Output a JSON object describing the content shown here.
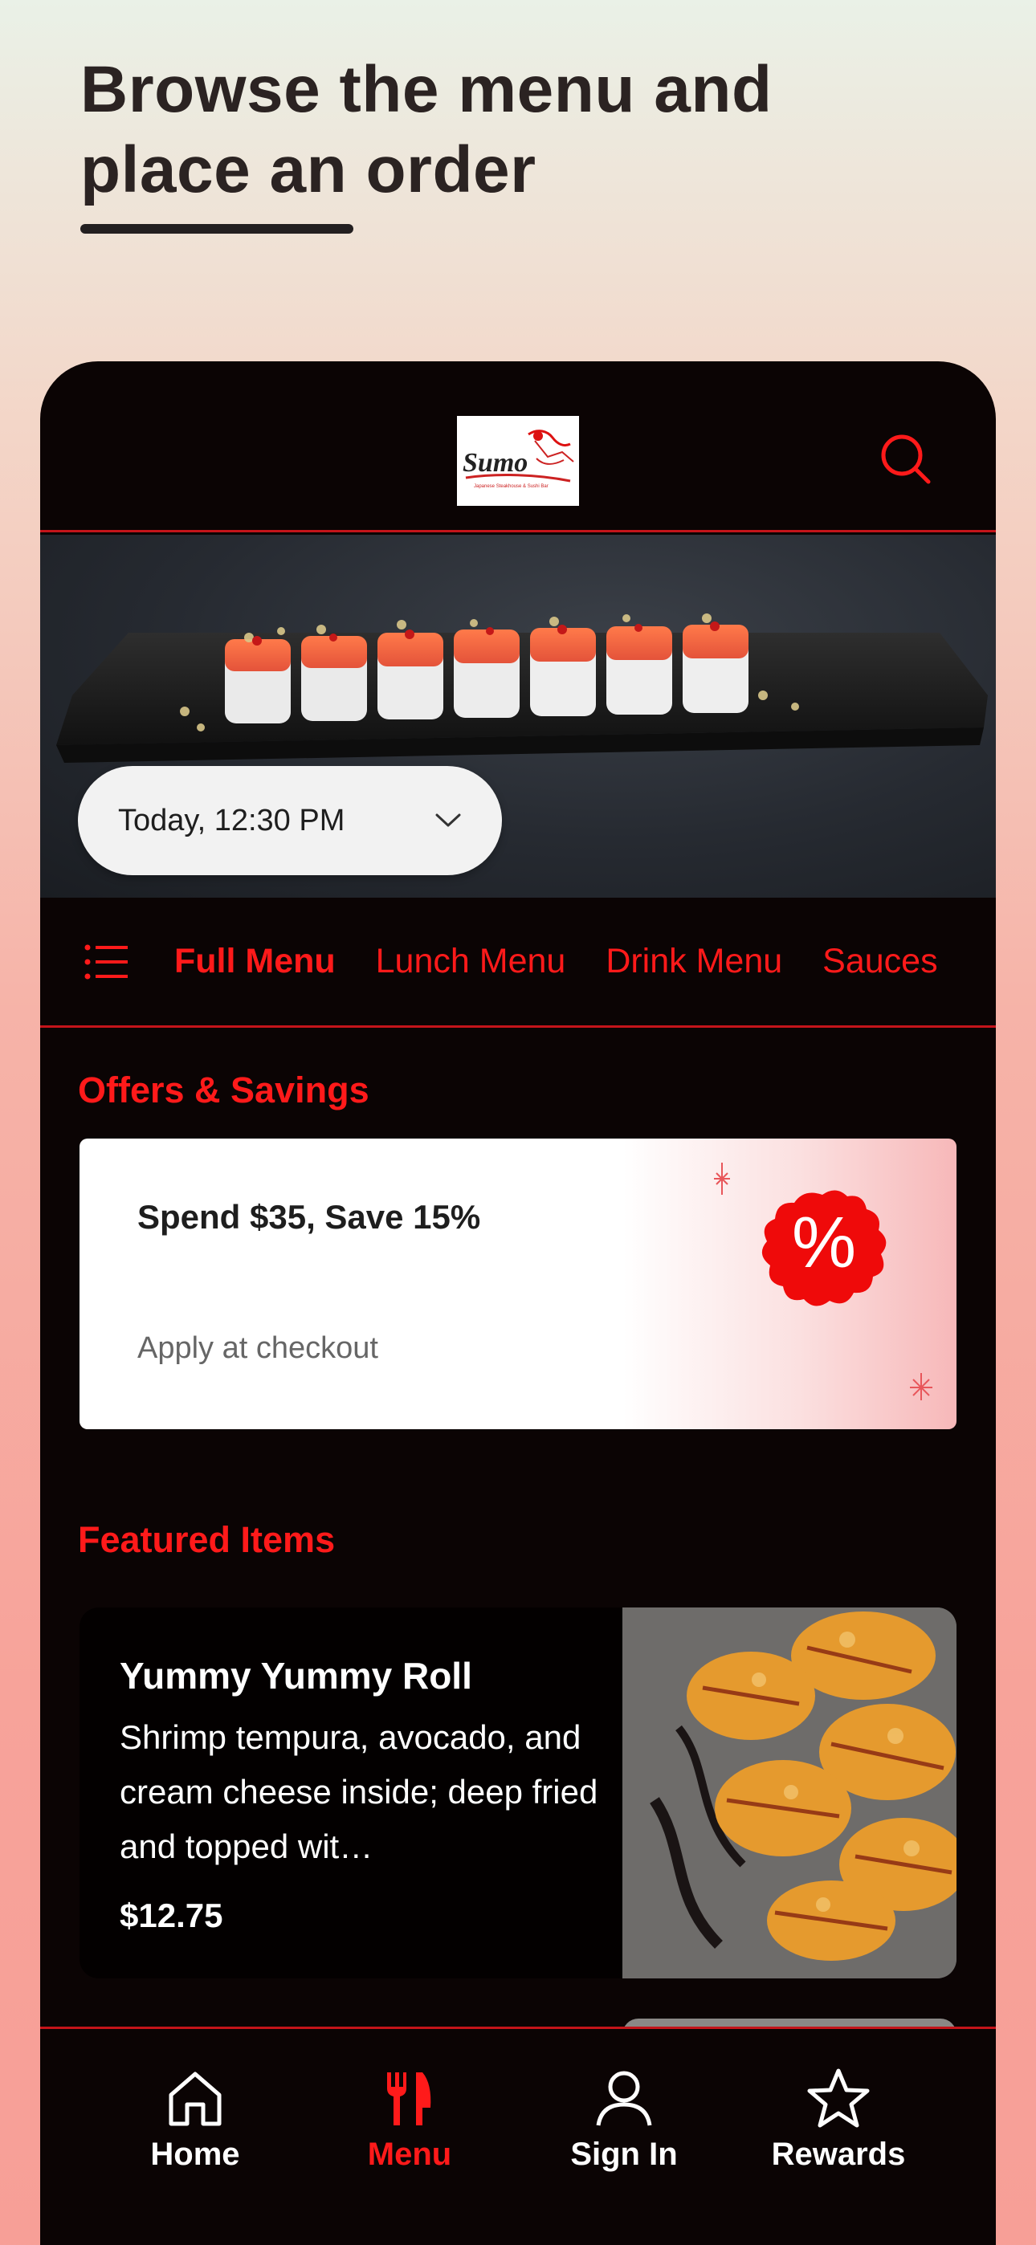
{
  "headline": {
    "line1": "Browse the menu and",
    "line2": "place an order"
  },
  "header": {
    "logo_text": "Sumo",
    "logo_subtext": "Japanese Steakhouse & Sushi Bar",
    "search_icon": "search-icon"
  },
  "order_time": {
    "value": "Today, 12:30 PM",
    "icon": "chevron-down-icon"
  },
  "tabs": [
    {
      "label": "Full Menu",
      "active": true
    },
    {
      "label": "Lunch Menu",
      "active": false
    },
    {
      "label": "Drink Menu",
      "active": false
    },
    {
      "label": "Sauces",
      "active": false
    }
  ],
  "offers": {
    "section_title": "Offers & Savings",
    "card": {
      "title": "Spend $35, Save 15%",
      "subtitle": "Apply at checkout",
      "badge_symbol": "%"
    }
  },
  "featured": {
    "section_title": "Featured Items",
    "items": [
      {
        "name": "Yummy Yummy Roll",
        "description": "Shrimp tempura, avocado, and cream cheese inside; deep fried and topped wit…",
        "price": "$12.75"
      }
    ]
  },
  "bottom_nav": [
    {
      "label": "Home",
      "icon": "home-icon",
      "active": false
    },
    {
      "label": "Menu",
      "icon": "fork-knife-icon",
      "active": true
    },
    {
      "label": "Sign In",
      "icon": "user-icon",
      "active": false
    },
    {
      "label": "Rewards",
      "icon": "star-icon",
      "active": false
    }
  ],
  "colors": {
    "accent": "#ff1a1a",
    "app_background": "#0b0404",
    "divider": "#c4141a"
  }
}
